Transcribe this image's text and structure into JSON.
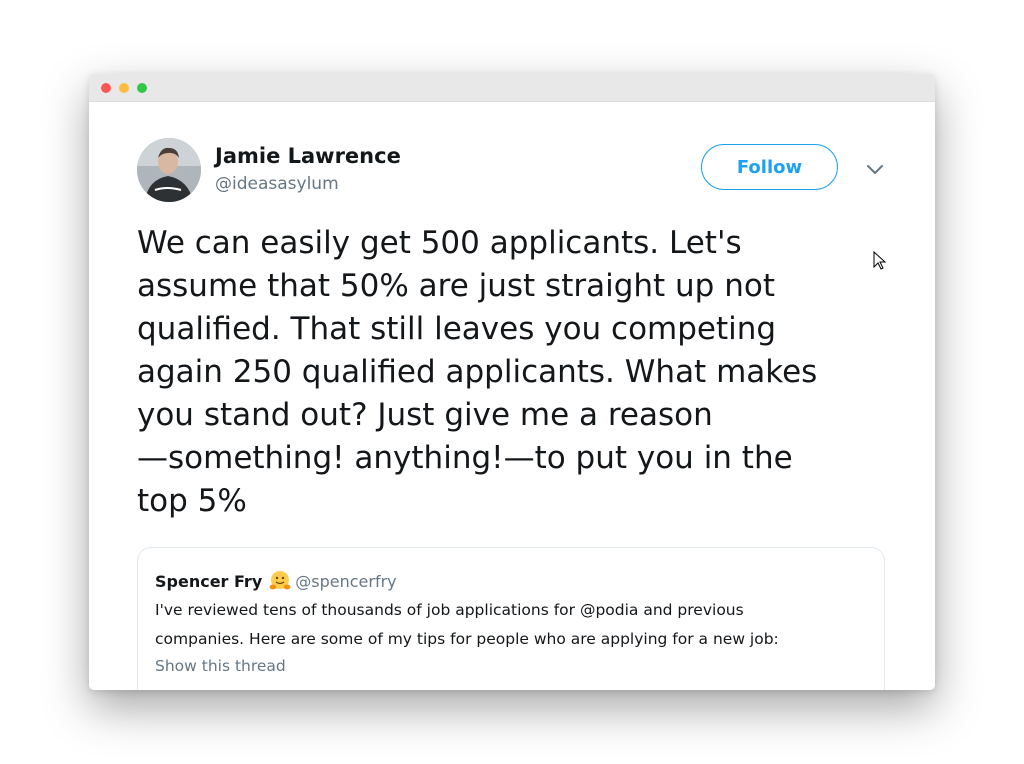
{
  "author": {
    "name": "Jamie Lawrence",
    "handle": "@ideasasylum",
    "avatar_icon": "profile-photo"
  },
  "header": {
    "follow_label": "Follow",
    "more_icon": "chevron-down-icon"
  },
  "tweet": {
    "text": "We can easily get 500 applicants. Let's\nassume that 50% are just straight up not\nqualified. That still leaves you competing\nagain 250 qualified applicants. What makes\nyou stand out? Just give me a reason\n—something! anything!—to put you in the\ntop 5%"
  },
  "quoted_tweet": {
    "name": "Spencer Fry",
    "emoji_icon": "hugging-face-emoji",
    "handle": "@spencerfry",
    "text": "I've reviewed tens of thousands of job applications for @podia and previous\ncompanies. Here are some of my tips for people who are applying for a new job:",
    "show_thread_label": "Show this thread"
  },
  "colors": {
    "accent": "#1da1f2",
    "text_primary": "#14171a",
    "text_secondary": "#657786",
    "border": "#e1e8ed",
    "window_red": "#fc5753",
    "window_yellow": "#fdbc40",
    "window_green": "#33c748"
  }
}
